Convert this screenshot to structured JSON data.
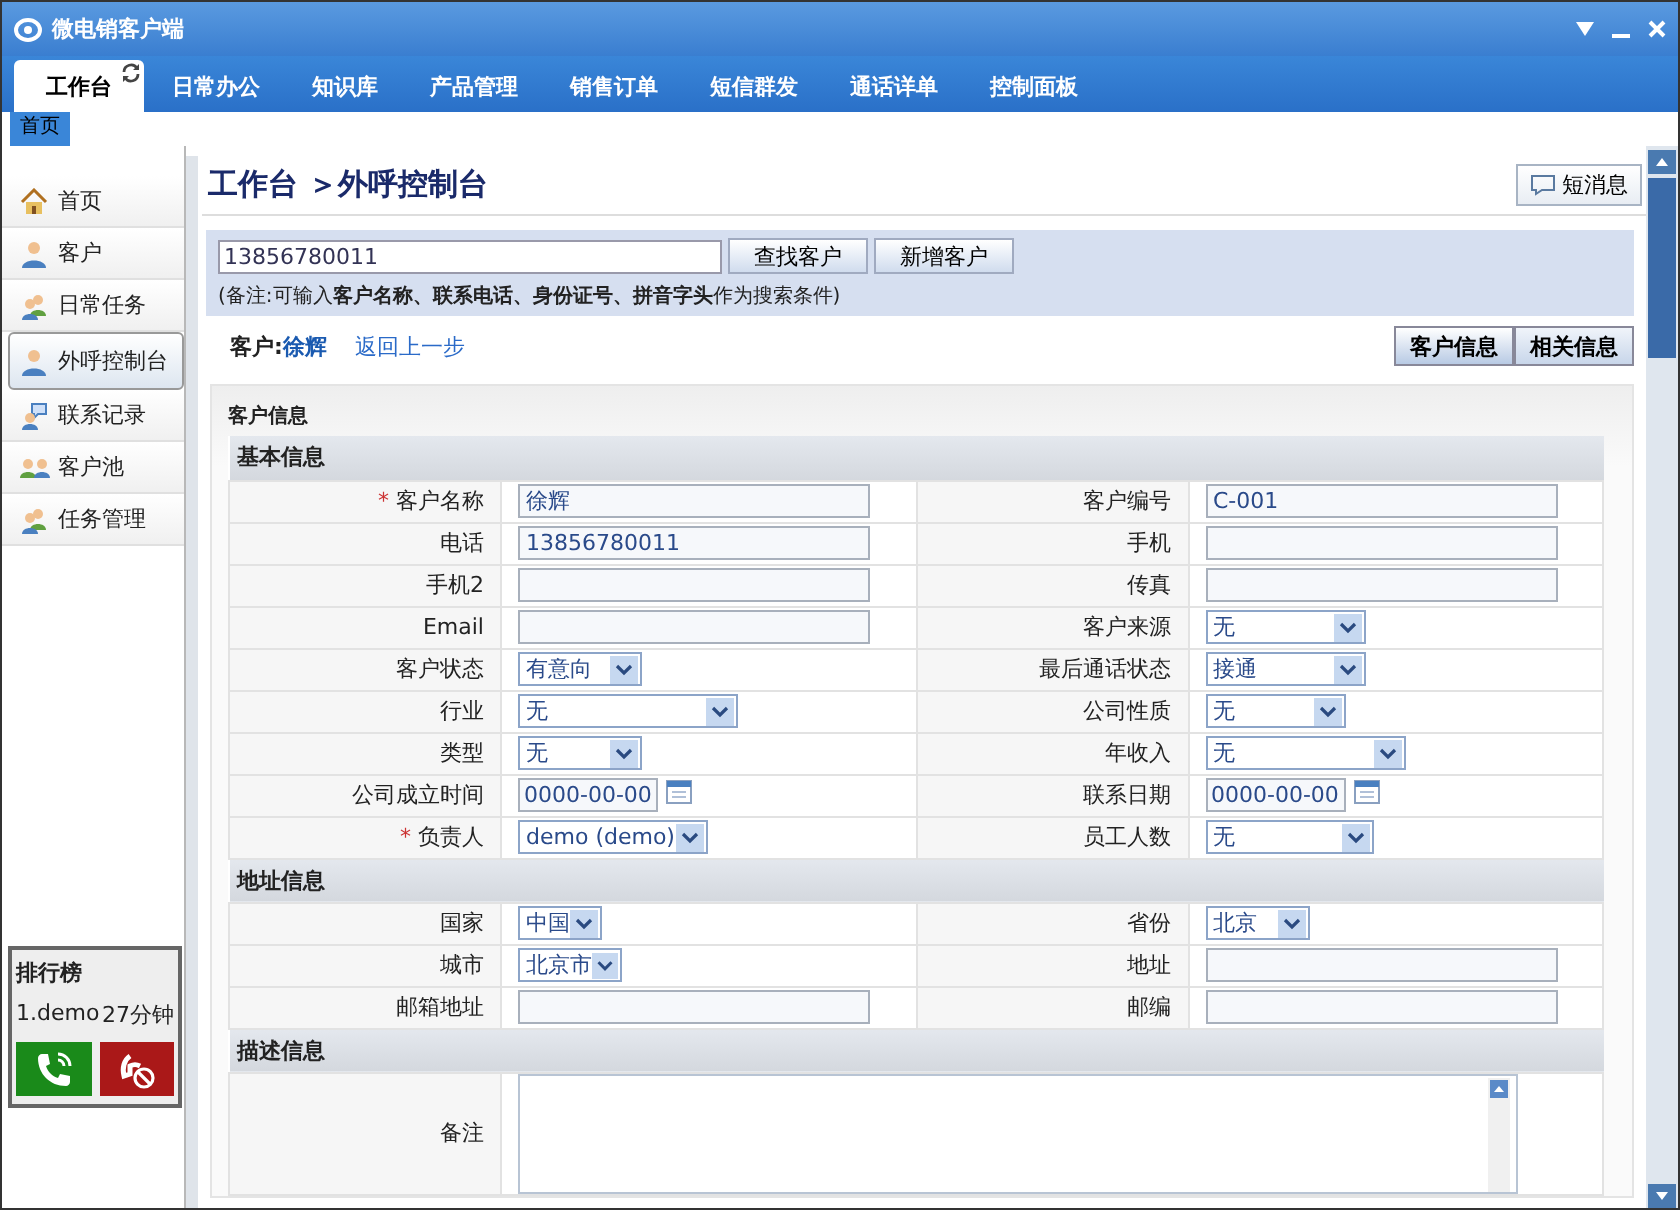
{
  "window": {
    "title": "微电销客户端"
  },
  "tabs": [
    {
      "label": "工作台",
      "selected": true
    },
    {
      "label": "日常办公",
      "selected": false
    },
    {
      "label": "知识库",
      "selected": false
    },
    {
      "label": "产品管理",
      "selected": false
    },
    {
      "label": "销售订单",
      "selected": false
    },
    {
      "label": "短信群发",
      "selected": false
    },
    {
      "label": "通话详单",
      "selected": false
    },
    {
      "label": "控制面板",
      "selected": false
    }
  ],
  "page_tabs": [
    {
      "label": "首页",
      "selected": true
    }
  ],
  "sidebar": {
    "items": [
      {
        "label": "首页",
        "selected": false,
        "kind": "home"
      },
      {
        "label": "客户",
        "selected": false,
        "kind": "person"
      },
      {
        "label": "日常任务",
        "selected": false,
        "kind": "people"
      },
      {
        "label": "外呼控制台",
        "selected": true,
        "kind": "person"
      },
      {
        "label": "联系记录",
        "selected": false,
        "kind": "chat"
      },
      {
        "label": "客户池",
        "selected": false,
        "kind": "group"
      },
      {
        "label": "任务管理",
        "selected": false,
        "kind": "people"
      }
    ],
    "ranking": {
      "title": "排行榜",
      "entries": [
        {
          "name": "1.demo",
          "time": "27分钟"
        }
      ]
    }
  },
  "header": {
    "breadcrumb": "工作台 ＞外呼控制台",
    "message_button": "短消息"
  },
  "search": {
    "value": "13856780011",
    "buttons": [
      "查找客户",
      "新增客户"
    ],
    "note": "(备注:可输入**客户名称、联系电话、身份证号、拼音字头**作为搜索条件)"
  },
  "customer_bar": {
    "label": "客户:",
    "name": "徐辉",
    "back_link": "返回上一步",
    "tabs": [
      {
        "label": "客户信息",
        "selected": true
      },
      {
        "label": "相关信息",
        "selected": false
      }
    ]
  },
  "form": {
    "title": "客户信息",
    "sections": [
      {
        "title": "基本信息",
        "rows": [
          [
            {
              "label": "客户名称",
              "marker": "*",
              "kind": "text",
              "value": "徐辉"
            },
            {
              "label": "客户编号",
              "kind": "text",
              "value": "C-001"
            }
          ],
          [
            {
              "label": "电话",
              "kind": "text",
              "value": "13856780011"
            },
            {
              "label": "手机",
              "kind": "text"
            }
          ],
          [
            {
              "label": "手机2",
              "kind": "text"
            },
            {
              "label": "传真",
              "kind": "text"
            }
          ],
          [
            {
              "label": "Email",
              "kind": "text"
            },
            {
              "label": "客户来源",
              "kind": "select",
              "value": "无"
            }
          ],
          [
            {
              "label": "客户状态",
              "kind": "select",
              "value": "有意向"
            },
            {
              "label": "最后通话状态",
              "kind": "select",
              "value": "接通"
            }
          ],
          [
            {
              "label": "行业",
              "kind": "select",
              "value": "无"
            },
            {
              "label": "公司性质",
              "kind": "select",
              "value": "无"
            }
          ],
          [
            {
              "label": "类型",
              "kind": "select",
              "value": "无"
            },
            {
              "label": "年收入",
              "kind": "select",
              "value": "无"
            }
          ],
          [
            {
              "label": "公司成立时间",
              "kind": "date",
              "value": "0000-00-00"
            },
            {
              "label": "联系日期",
              "kind": "date",
              "value": "0000-00-00"
            }
          ],
          [
            {
              "label": "负责人",
              "marker": "*",
              "kind": "select",
              "value": "demo (demo)"
            },
            {
              "label": "员工人数",
              "kind": "select",
              "value": "无"
            }
          ]
        ]
      },
      {
        "title": "地址信息",
        "rows": [
          [
            {
              "label": "国家",
              "kind": "select",
              "value": "中国"
            },
            {
              "label": "省份",
              "kind": "select",
              "value": "北京"
            }
          ],
          [
            {
              "label": "城市",
              "kind": "select",
              "value": "北京市"
            },
            {
              "label": "地址",
              "kind": "text"
            }
          ],
          [
            {
              "label": "邮箱地址",
              "kind": "text"
            },
            {
              "label": "邮编",
              "kind": "text"
            }
          ]
        ]
      },
      {
        "title": "描述信息",
        "rows": [
          [
            {
              "label": "备注",
              "kind": "textarea"
            }
          ]
        ]
      }
    ]
  }
}
